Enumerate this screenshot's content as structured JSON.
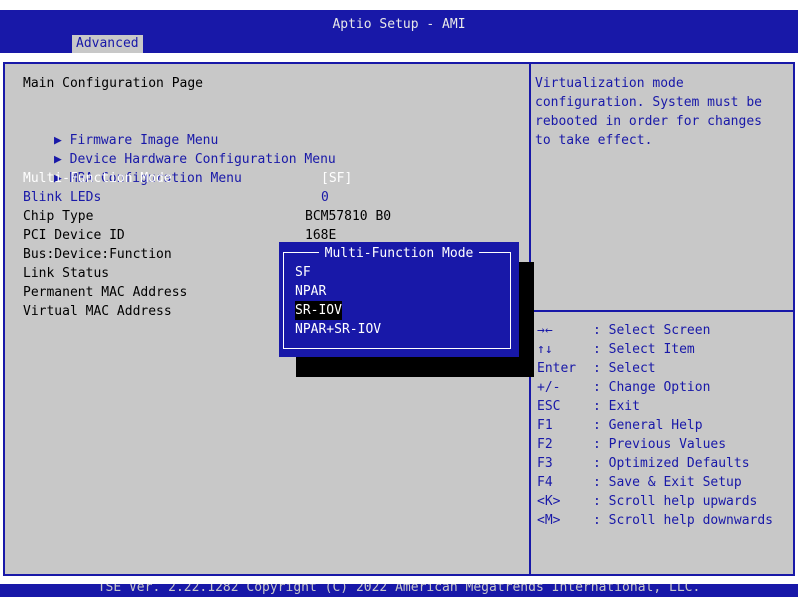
{
  "header": {
    "title": "Aptio Setup - AMI",
    "tab": "Advanced"
  },
  "main": {
    "page_title": "Main Configuration Page",
    "submenus": [
      {
        "arrow": "▶",
        "label": "Firmware Image Menu"
      },
      {
        "arrow": "▶",
        "label": "Device Hardware Configuration Menu"
      },
      {
        "arrow": "▶",
        "label": "MBA Configuration Menu"
      }
    ],
    "settings": [
      {
        "label": "Multi-Function Mode",
        "value": "[SF]"
      },
      {
        "label": "Blink LEDs",
        "value": "0"
      },
      {
        "label": "Chip Type",
        "value": "BCM57810 B0"
      },
      {
        "label": "PCI Device ID",
        "value": "168E"
      },
      {
        "label": "Bus:Device:Function",
        "value": ""
      },
      {
        "label": "Link Status",
        "value": ""
      },
      {
        "label": "Permanent MAC Address",
        "value": ""
      },
      {
        "label": "Virtual MAC Address",
        "value": ""
      }
    ]
  },
  "help": {
    "text_lines": [
      "Virtualization mode",
      "configuration. System must be",
      "rebooted in order for changes",
      "to take effect."
    ],
    "keys": [
      {
        "key": "→←",
        "desc": ": Select Screen"
      },
      {
        "key": "↑↓",
        "desc": ": Select Item"
      },
      {
        "key": "Enter",
        "desc": ": Select"
      },
      {
        "key": "+/-",
        "desc": ": Change Option"
      },
      {
        "key": "ESC",
        "desc": ": Exit"
      },
      {
        "key": "F1",
        "desc": ": General Help"
      },
      {
        "key": "F2",
        "desc": ": Previous Values"
      },
      {
        "key": "F3",
        "desc": ": Optimized Defaults"
      },
      {
        "key": "F4",
        "desc": ": Save & Exit Setup"
      },
      {
        "key": "<K>",
        "desc": ": Scroll help upwards"
      },
      {
        "key": "<M>",
        "desc": ": Scroll help downwards"
      }
    ]
  },
  "popup": {
    "title": "Multi-Function Mode",
    "options": [
      "SF",
      "NPAR",
      "SR-IOV",
      "NPAR+SR-IOV"
    ],
    "selected": "SR-IOV"
  },
  "footer": {
    "text": "TSE Ver. 2.22.1282  Copyright (C) 2022 American Megatrends International, LLC."
  },
  "colors": {
    "bios_blue": "#1818a8",
    "panel_gray": "#c8c8c8",
    "white": "#ffffff",
    "black": "#000000"
  }
}
